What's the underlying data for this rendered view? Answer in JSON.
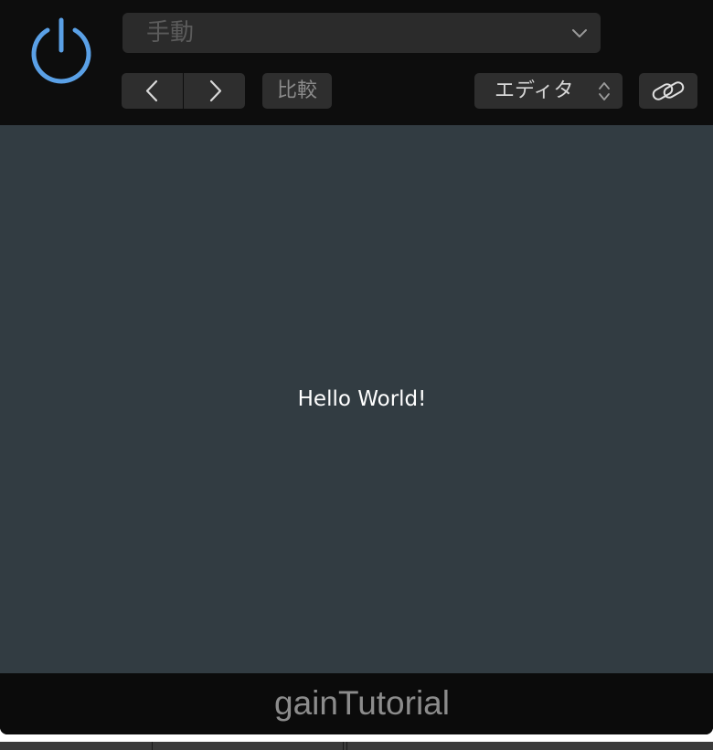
{
  "header": {
    "preset": {
      "label": "手動",
      "chevron_icon": "chevron-down-icon"
    },
    "navigation": {
      "prev_icon": "chevron-left-icon",
      "next_icon": "chevron-right-icon"
    },
    "compare_label": "比較",
    "view": {
      "label": "エディタ",
      "icon": "up-down-chevron-icon"
    },
    "link_icon": "link-icon",
    "power_icon": "power-icon"
  },
  "content": {
    "message": "Hello World!"
  },
  "footer": {
    "plugin_name": "gainTutorial"
  },
  "colors": {
    "accent": "#5aa0e6",
    "header_bg": "#0d0d0d",
    "content_bg": "#323c42",
    "button_bg": "#2e2e2e"
  }
}
